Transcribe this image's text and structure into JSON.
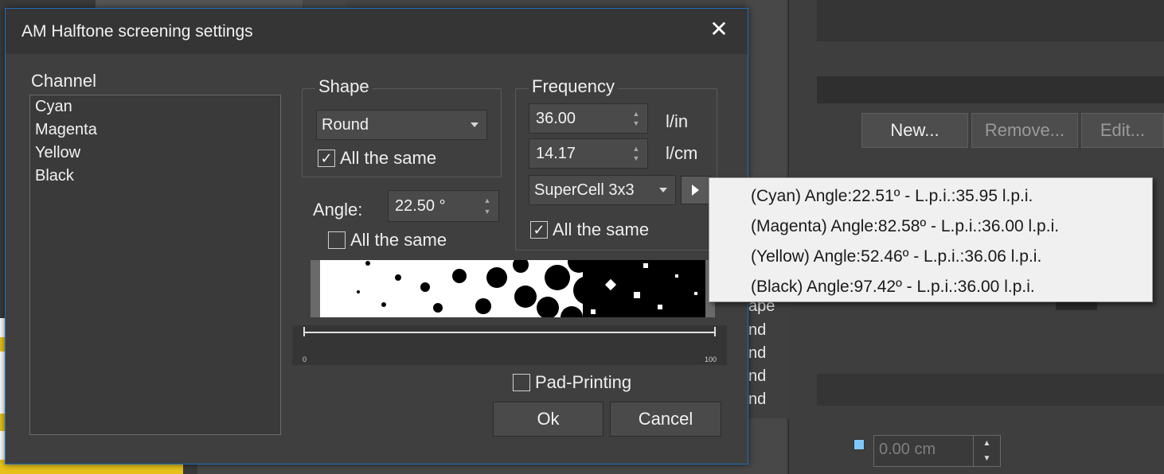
{
  "dialog": {
    "title": "AM Halftone screening settings",
    "close_label": "✕"
  },
  "channel": {
    "label": "Channel",
    "items": [
      "Cyan",
      "Magenta",
      "Yellow",
      "Black"
    ]
  },
  "shape": {
    "label": "Shape",
    "selected": "Round",
    "all_same_label": "All the same",
    "all_same_checked": true
  },
  "frequency": {
    "label": "Frequency",
    "lin_value": "36.00",
    "lin_unit": "l/in",
    "lcm_value": "14.17",
    "lcm_unit": "l/cm",
    "cell_selected": "SuperCell 3x3",
    "all_same_label": "All the same",
    "all_same_checked": true
  },
  "angle": {
    "label": "Angle:",
    "value": "22.50 °",
    "all_same_label": "All the same",
    "all_same_checked": false
  },
  "slider": {
    "min_label": "0",
    "max_label": "100"
  },
  "pad_printing": {
    "label": "Pad-Printing",
    "checked": false
  },
  "buttons": {
    "ok": "Ok",
    "cancel": "Cancel"
  },
  "popup": {
    "items": [
      "(Cyan) Angle:22.51º - L.p.i.:35.95 l.p.i.",
      "(Magenta) Angle:82.58º - L.p.i.:36.00 l.p.i.",
      "(Yellow) Angle:52.46º - L.p.i.:36.06 l.p.i.",
      "(Black) Angle:97.42º - L.p.i.:36.00 l.p.i."
    ]
  },
  "background": {
    "new_button": "New...",
    "remove_button": "Remove...",
    "edit_button": "Edit...",
    "shape_list_header": "ape",
    "shape_list_items": [
      "nd",
      "nd",
      "nd",
      "nd"
    ],
    "offset_field": "0.00 cm"
  },
  "colors": {
    "dialog_bg": "#3f3f3f",
    "title_bg": "#353535",
    "accent_border": "#1f6fbf",
    "popup_bg": "#f0f0f0"
  }
}
